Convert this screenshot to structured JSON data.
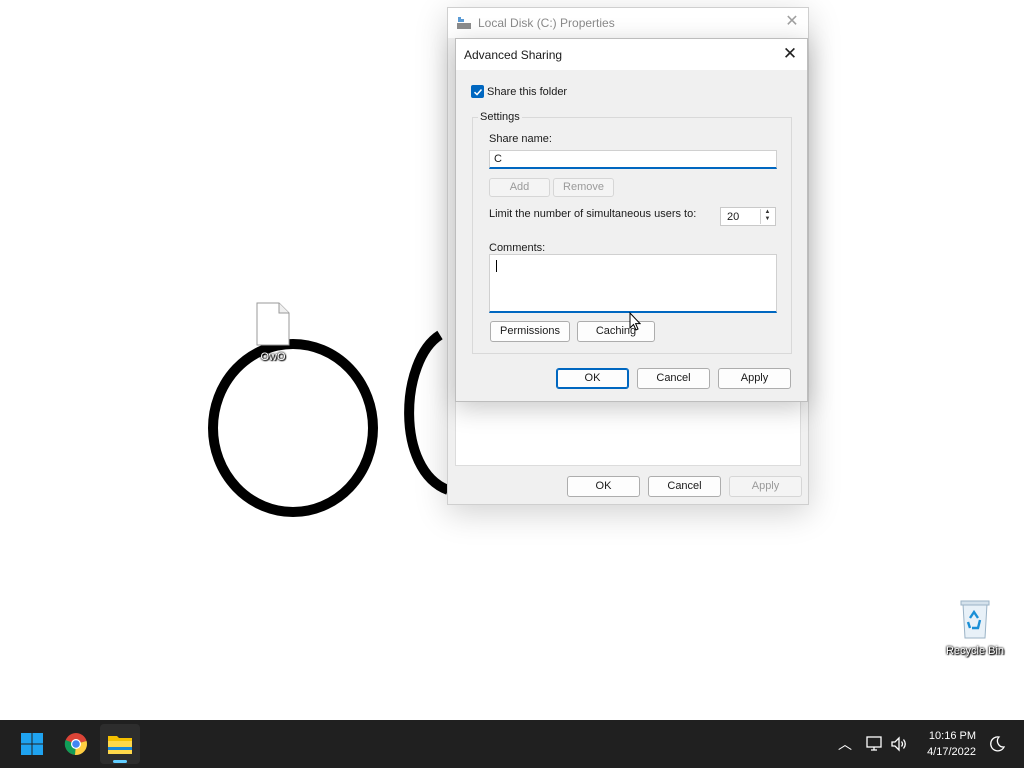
{
  "desktop": {
    "file_icon_label": "OwO",
    "recycle_bin_label": "Recycle Bin"
  },
  "properties_window": {
    "title": "Local Disk (C:) Properties",
    "buttons": {
      "ok": "OK",
      "cancel": "Cancel",
      "apply": "Apply"
    }
  },
  "advanced_sharing": {
    "title": "Advanced Sharing",
    "share_checkbox_label": "Share this folder",
    "share_checked": true,
    "settings_legend": "Settings",
    "share_name_label": "Share name:",
    "share_name_value": "C",
    "add_label": "Add",
    "remove_label": "Remove",
    "limit_label": "Limit the number of simultaneous users to:",
    "limit_value": "20",
    "comments_label": "Comments:",
    "comments_value": "",
    "permissions_label": "Permissions",
    "caching_label": "Caching",
    "buttons": {
      "ok": "OK",
      "cancel": "Cancel",
      "apply": "Apply"
    }
  },
  "taskbar": {
    "time": "10:16 PM",
    "date": "4/17/2022",
    "colors": {
      "background": "#202020",
      "accent": "#60cdff"
    }
  }
}
